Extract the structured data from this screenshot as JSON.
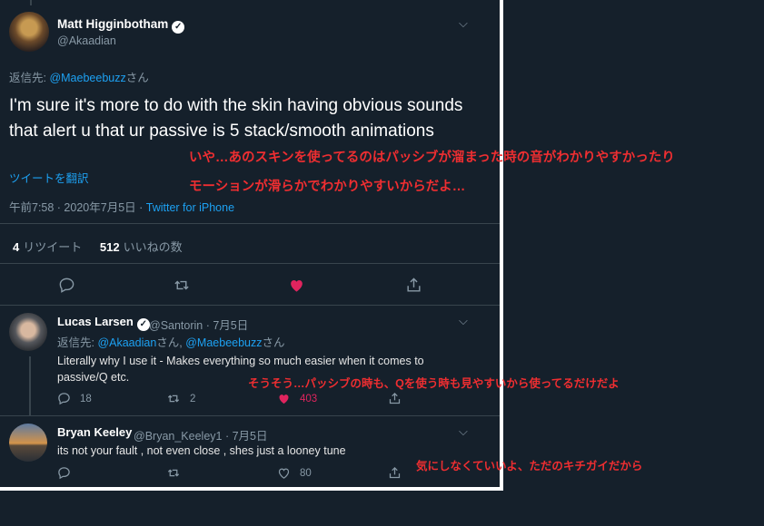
{
  "main_tweet": {
    "display_name": "Matt Higginbotham",
    "handle": "@Akaadian",
    "reply_prefix": "返信先: ",
    "reply_to": "@Maebeebuzz",
    "reply_suffix": "さん",
    "text": "I'm sure it's more to do with the skin having obvious sounds that alert u that ur passive is 5 stack/smooth animations",
    "translate_label": "ツイートを翻訳",
    "time": "午前7:58 · 2020年7月5日 · ",
    "source": "Twitter for iPhone",
    "retweets_count": "4",
    "retweets_label": "リツイート",
    "likes_count": "512",
    "likes_label": "いいねの数"
  },
  "annotations": {
    "main_line1": "いや…あのスキンを使ってるのはパッシブが溜まった時の音がわかりやすかったり",
    "main_line2": "モーションが滑らかでわかりやすいからだよ…",
    "lucas": "そうそう…パッシブの時も、Qを使う時も見やすいから使ってるだけだよ",
    "bryan": "気にしなくていいよ、ただのキチガイだから"
  },
  "replies": [
    {
      "display_name": "Lucas Larsen",
      "handle_date": "@Santorin · 7月5日",
      "reply_prefix": "返信先: ",
      "reply_to_1": "@Akaadian",
      "reply_mid": "さん, ",
      "reply_to_2": "@Maebeebuzz",
      "reply_suffix": "さん",
      "text": "Literally why I use it - Makes everything so much easier when it comes to passive/Q etc.",
      "reply_count": "18",
      "retweet_count": "2",
      "like_count": "403"
    },
    {
      "display_name": "Bryan Keeley",
      "handle_date": "@Bryan_Keeley1 · 7月5日",
      "text": "its not your fault , not even close , shes just a looney tune",
      "like_count": "80"
    }
  ],
  "colors": {
    "background": "#15202b",
    "accent": "#1da1f2",
    "like": "#e0245e",
    "annotation": "#ee2e31"
  }
}
